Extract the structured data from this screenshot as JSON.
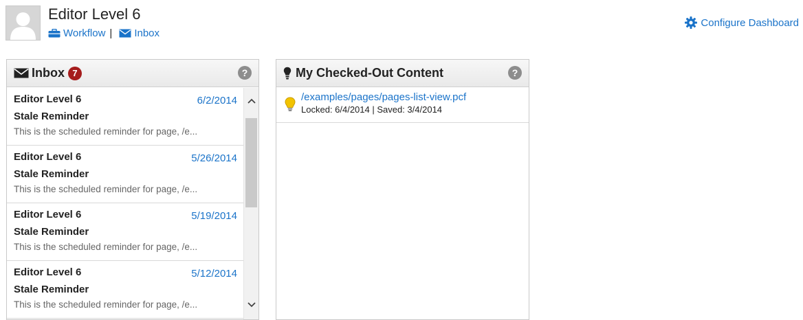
{
  "user": {
    "name": "Editor Level 6",
    "workflow_label": "Workflow",
    "separator": "|",
    "inbox_label": "Inbox"
  },
  "configure_dashboard_label": "Configure Dashboard",
  "inbox": {
    "title": "Inbox",
    "badge_count": "7",
    "help_label": "?",
    "messages": [
      {
        "from": "Editor Level 6",
        "date": "6/2/2014",
        "subject": "Stale Reminder",
        "preview": "This is the scheduled reminder for page, /e..."
      },
      {
        "from": "Editor Level 6",
        "date": "5/26/2014",
        "subject": "Stale Reminder",
        "preview": "This is the scheduled reminder for page, /e..."
      },
      {
        "from": "Editor Level 6",
        "date": "5/19/2014",
        "subject": "Stale Reminder",
        "preview": "This is the scheduled reminder for page, /e..."
      },
      {
        "from": "Editor Level 6",
        "date": "5/12/2014",
        "subject": "Stale Reminder",
        "preview": "This is the scheduled reminder for page, /e..."
      }
    ]
  },
  "checked_out": {
    "title": "My Checked-Out Content",
    "help_label": "?",
    "items": [
      {
        "path": "/examples/pages/pages-list-view.pcf",
        "meta": "Locked: 6/4/2014 | Saved: 3/4/2014"
      }
    ]
  },
  "icons": {
    "avatar": "user-placeholder-icon",
    "workflow": "briefcase-icon",
    "inbox": "envelope-icon",
    "configure": "gear-icon",
    "checked_out": "lightbulb-icon",
    "help": "question-icon",
    "item": "yellow-lightbulb-icon"
  },
  "colors": {
    "link": "#1a73c9",
    "badge": "#a51c1c",
    "bulb": "#f2c300"
  }
}
